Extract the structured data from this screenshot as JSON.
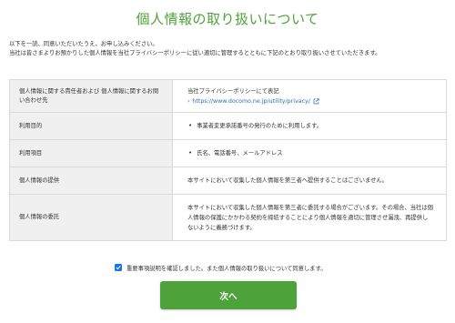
{
  "page": {
    "title": "個人情報の取り扱いについて",
    "intro_line1": "以下を一読、同意いただいたうえ、お申し込みください。",
    "intro_line2": "当社は皆さまよりお預かりした個人情報を当社プライバシーポリシーに従い適切に管理するとともに下記のとおり取り扱いさせていただきます。"
  },
  "table": {
    "rows": [
      {
        "head": "個人情報に関する責任者および 個人情報に関するお問い合わせ先",
        "body_text": "当社プライバシーポリシーにて表記",
        "link_text": "https://www.docomo.ne.jp/utility/privacy/"
      },
      {
        "head": "利用目的",
        "bullet": "事業者変更承諾番号の発行のために利用します。"
      },
      {
        "head": "利用項目",
        "bullet": "氏名、電話番号、メールアドレス"
      },
      {
        "head": "個人情報の提供",
        "body_text": "本サイトにおいて収集した個人情報を第三者へ提供することはございません。"
      },
      {
        "head": "個人情報の委託",
        "body_text": "本サイトにおいて収集した個人情報を第三者に委託する場合がございます。その場合、当社は個人情報の保護にかかわる契約を締結することにより個人情報を適切に管理させ漏洩、再提供しないように義務づけます。"
      }
    ]
  },
  "agreement": {
    "checked": true,
    "label": "重要事項説明を確認しました。また個人情報の取り扱いについて同意します。"
  },
  "next_button": {
    "label": "次へ"
  },
  "colors": {
    "accent": "#4ea23a",
    "link": "#2b6fb6",
    "checkbox": "#1a73e8"
  }
}
